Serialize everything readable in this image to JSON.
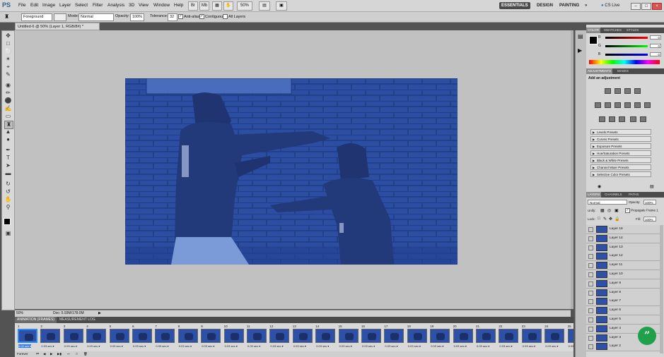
{
  "app": {
    "logo": "PS"
  },
  "menubar": {
    "items": [
      "File",
      "Edit",
      "Image",
      "Layer",
      "Select",
      "Filter",
      "Analysis",
      "3D",
      "View",
      "Window",
      "Help"
    ],
    "zoom": "50%",
    "workspaces": [
      "ESSENTIALS",
      "DESIGN",
      "PAINTING"
    ],
    "more": "»",
    "cslive": "CS Live"
  },
  "options": {
    "preset": "Foreground",
    "mode_label": "Mode:",
    "mode_value": "Normal",
    "opacity_label": "Opacity:",
    "opacity_value": "100%",
    "tolerance_label": "Tolerance:",
    "tolerance_value": "32",
    "antialias": "Anti-alias",
    "contiguous": "Contiguous",
    "all_layers": "All Layers"
  },
  "document": {
    "tab_title": "Untitled-6 @ 50% (Layer 1, RGB/8#) *",
    "status_zoom": "50%",
    "status_doc": "Doc: 5.93M/178.0M"
  },
  "animation": {
    "tabs": [
      "ANIMATION (FRAMES)",
      "MEASUREMENT LOG"
    ],
    "frames": [
      {
        "num": "1",
        "delay": "0.03 sec.▾"
      },
      {
        "num": "2",
        "delay": "0.03 sec.▾"
      },
      {
        "num": "3",
        "delay": "0.03 sec.▾"
      },
      {
        "num": "4",
        "delay": "0.03 sec.▾"
      },
      {
        "num": "5",
        "delay": "0.03 sec.▾"
      },
      {
        "num": "6",
        "delay": "0.03 sec.▾"
      },
      {
        "num": "7",
        "delay": "0.03 sec.▾"
      },
      {
        "num": "8",
        "delay": "0.03 sec.▾"
      },
      {
        "num": "9",
        "delay": "0.03 sec.▾"
      },
      {
        "num": "10",
        "delay": "0.03 sec.▾"
      },
      {
        "num": "11",
        "delay": "0.03 sec.▾"
      },
      {
        "num": "12",
        "delay": "0.03 sec.▾"
      },
      {
        "num": "13",
        "delay": "0.03 sec.▾"
      },
      {
        "num": "14",
        "delay": "0.03 sec.▾"
      },
      {
        "num": "15",
        "delay": "0.03 sec.▾"
      },
      {
        "num": "16",
        "delay": "0.03 sec.▾"
      },
      {
        "num": "17",
        "delay": "0.03 sec.▾"
      },
      {
        "num": "18",
        "delay": "0.03 sec.▾"
      },
      {
        "num": "19",
        "delay": "0.03 sec.▾"
      },
      {
        "num": "20",
        "delay": "0.03 sec.▾"
      },
      {
        "num": "21",
        "delay": "0.03 sec.▾"
      },
      {
        "num": "22",
        "delay": "0.03 sec.▾"
      },
      {
        "num": "23",
        "delay": "0.03 sec.▾"
      },
      {
        "num": "24",
        "delay": "0.03 sec.▾"
      },
      {
        "num": "25",
        "delay": "0.03 sec.▾"
      }
    ],
    "selected_frame": 1,
    "loop": "Forever"
  },
  "color_panel": {
    "tabs": [
      "COLOR",
      "SWATCHES",
      "STYLES"
    ],
    "channels": [
      {
        "label": "R",
        "value": "0"
      },
      {
        "label": "G",
        "value": "0"
      },
      {
        "label": "B",
        "value": "0"
      }
    ]
  },
  "adjustments_panel": {
    "tabs": [
      "ADJUSTMENTS",
      "MASKS"
    ],
    "heading": "Add an adjustment",
    "presets": [
      "Levels Presets",
      "Curves Presets",
      "Exposure Presets",
      "Hue/Saturation Presets",
      "Black & White Presets",
      "Channel Mixer Presets",
      "Selective Color Presets"
    ]
  },
  "layers_panel": {
    "tabs": [
      "LAYERS",
      "CHANNELS",
      "PATHS"
    ],
    "blend_mode": "Normal",
    "opacity_label": "Opacity:",
    "opacity_value": "100%",
    "unify_label": "Unify:",
    "propagate": "Propagate Frame 1",
    "lock_label": "Lock:",
    "fill_label": "Fill:",
    "fill_value": "100%",
    "layers": [
      "Layer 16",
      "Layer 14",
      "Layer 13",
      "Layer 12",
      "Layer 11",
      "Layer 10",
      "Layer 9",
      "Layer 8",
      "Layer 7",
      "Layer 6",
      "Layer 5",
      "Layer 4",
      "Layer 3",
      "Layer 2"
    ]
  },
  "overlay_button": {
    "glyph": "”"
  },
  "colors": {
    "canvas_blue": "#2a4a9e",
    "essentials_bg": "#4a4a4a",
    "green": "#1fa04a",
    "selection": "#3a7de0"
  }
}
